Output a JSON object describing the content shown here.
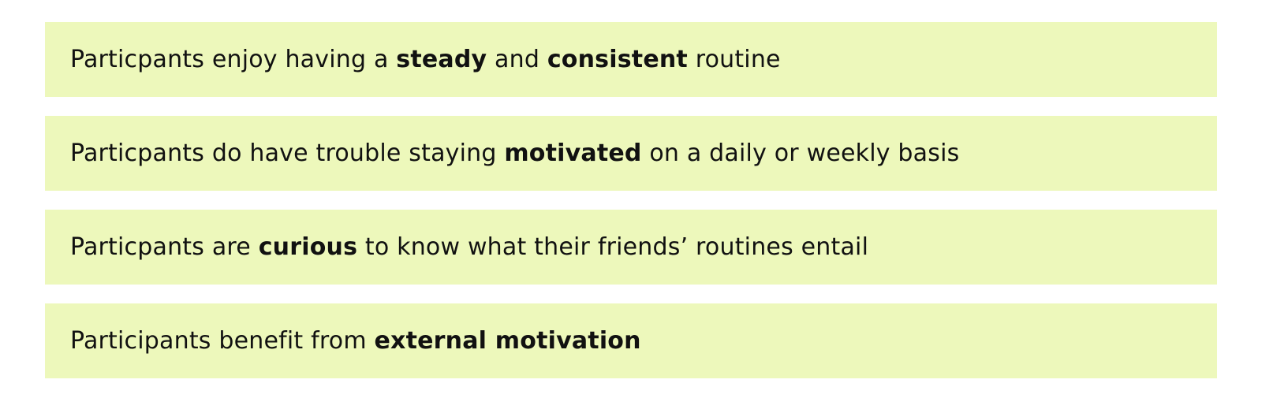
{
  "colors": {
    "card_background": "#edf8bb",
    "text": "#111111",
    "page_background": "#ffffff"
  },
  "insights": [
    {
      "segments": [
        {
          "text": "Particpants enjoy having a ",
          "bold": false
        },
        {
          "text": "steady",
          "bold": true
        },
        {
          "text": " and ",
          "bold": false
        },
        {
          "text": "consistent",
          "bold": true
        },
        {
          "text": " routine",
          "bold": false
        }
      ]
    },
    {
      "segments": [
        {
          "text": "Particpants do have trouble staying ",
          "bold": false
        },
        {
          "text": "motivated",
          "bold": true
        },
        {
          "text": " on a daily or weekly basis",
          "bold": false
        }
      ]
    },
    {
      "segments": [
        {
          "text": "Particpants are ",
          "bold": false
        },
        {
          "text": "curious",
          "bold": true
        },
        {
          "text": " to know what their friends’ routines entail",
          "bold": false
        }
      ]
    },
    {
      "segments": [
        {
          "text": "Participants benefit from ",
          "bold": false
        },
        {
          "text": "external motivation",
          "bold": true
        }
      ]
    }
  ]
}
